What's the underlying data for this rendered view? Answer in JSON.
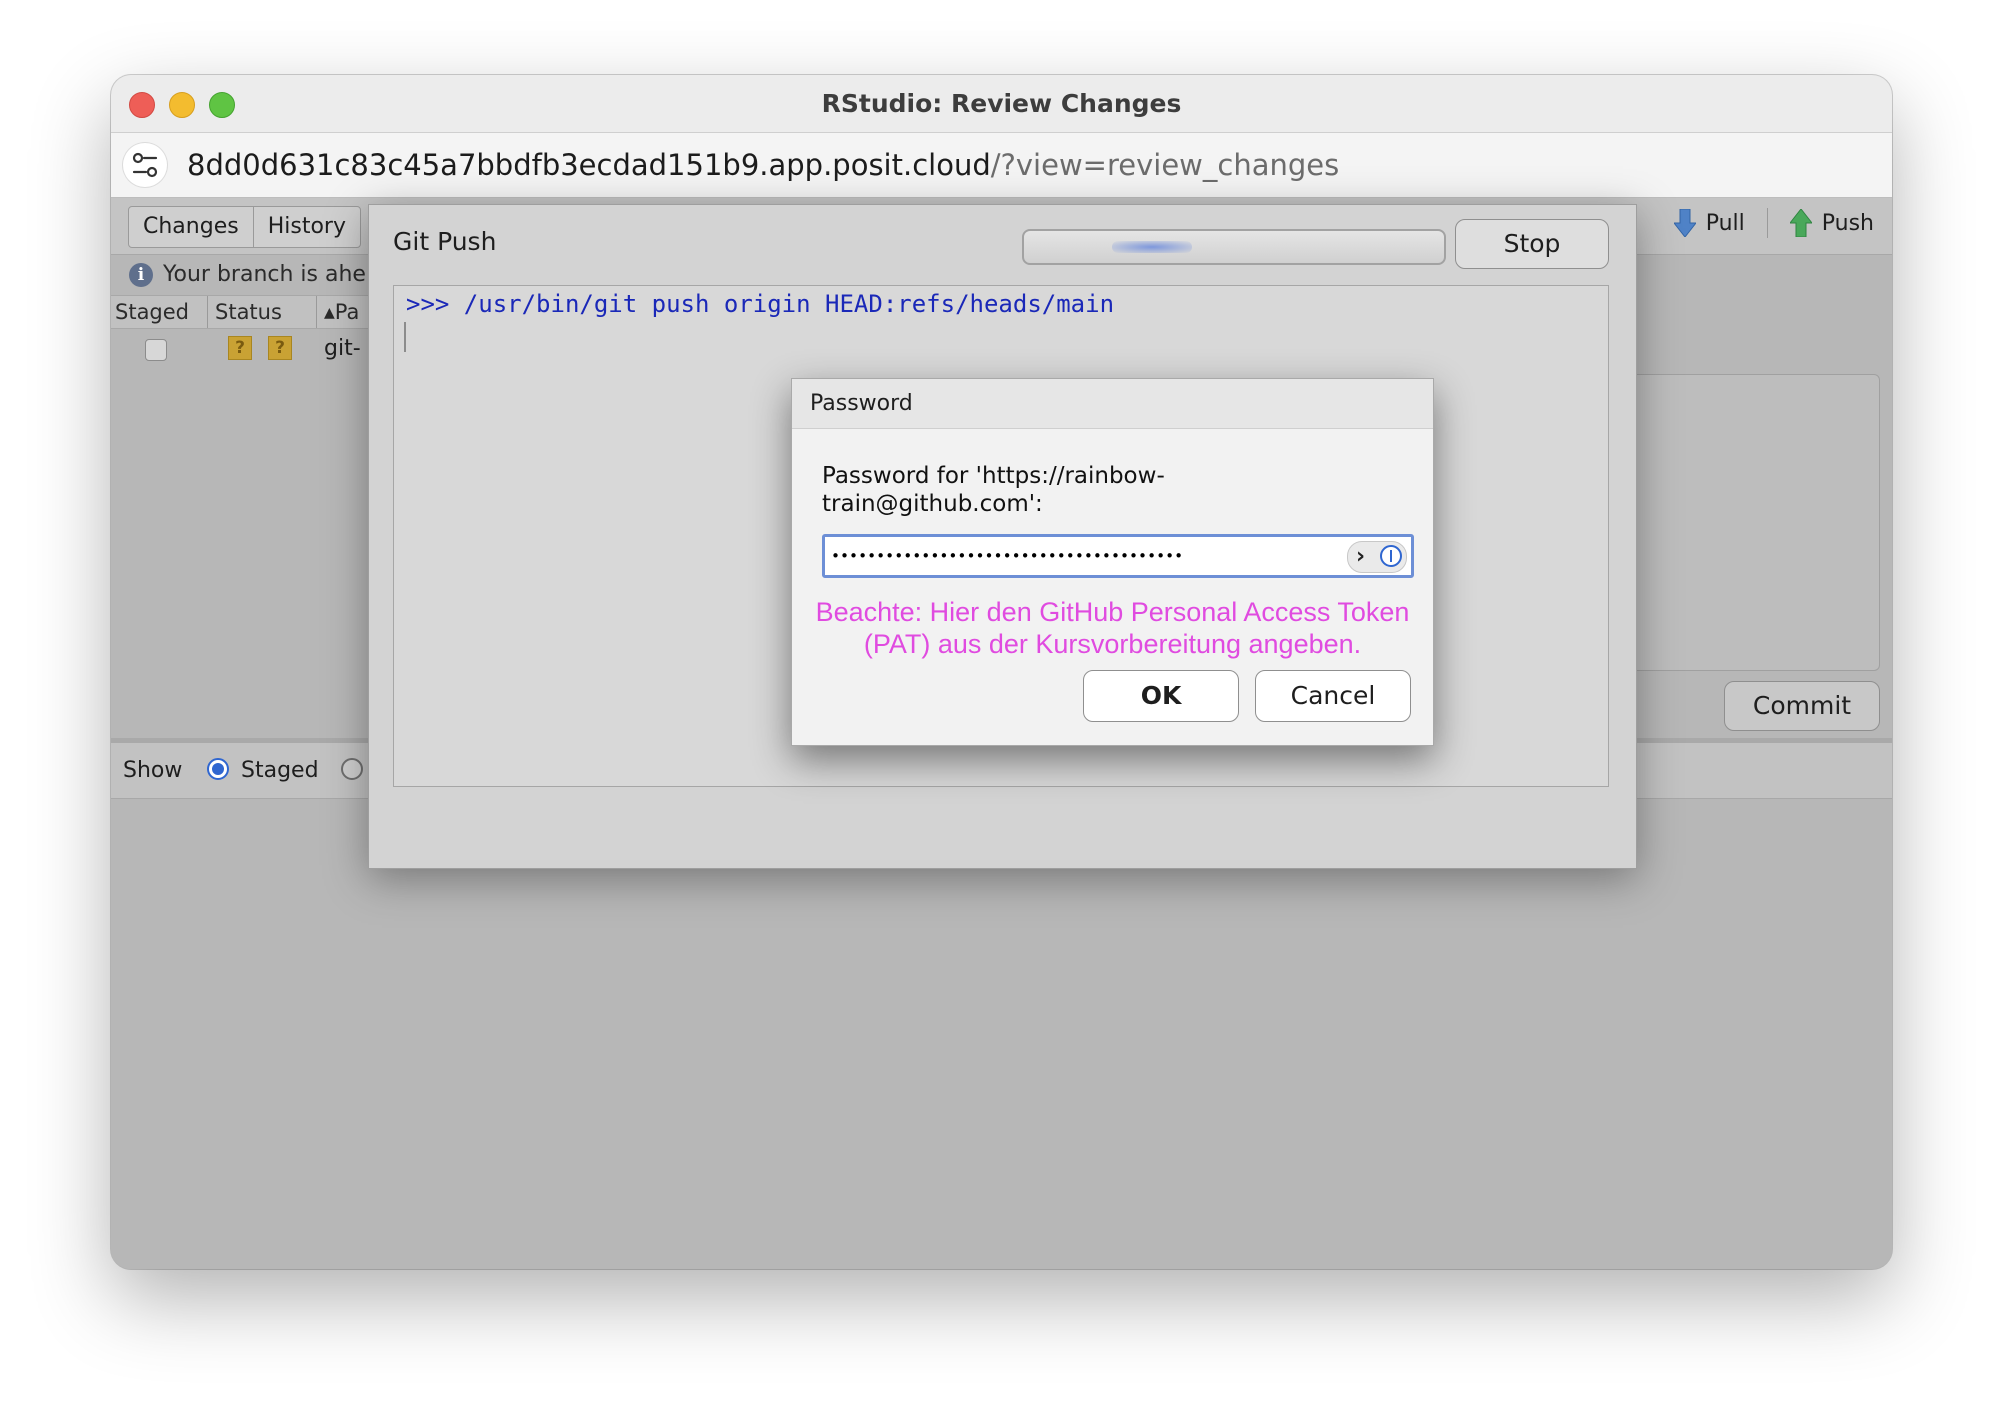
{
  "window": {
    "title": "RStudio: Review Changes",
    "url_host": "8dd0d631c83c45a7bbdfb3ecdad151b9.app.posit.cloud",
    "url_path": "/?view=review_changes"
  },
  "review": {
    "tabs": [
      {
        "label": "Changes"
      },
      {
        "label": "History"
      }
    ],
    "pull_label": "Pull",
    "push_label": "Push",
    "info_text": "Your branch is ahe",
    "columns": {
      "staged": "Staged",
      "status": "Status",
      "path": "Pa"
    },
    "file_row": {
      "name": "git-",
      "badge1": "?",
      "badge2": "?"
    },
    "commit_label": "Commit",
    "show_label": "Show",
    "staged_option": "Staged"
  },
  "git_push": {
    "title": "Git Push",
    "stop_label": "Stop",
    "console_line": ">>> /usr/bin/git push origin HEAD:refs/heads/main"
  },
  "password_dialog": {
    "title": "Password",
    "prompt_line1": "Password for 'https://rainbow-",
    "prompt_line2": "train@github.com':",
    "masked_value": "•••••••••••••••••••••••••••••••••••••••",
    "note_line1": "Beachte: Hier den GitHub Personal Access Token",
    "note_line2": "(PAT) aus der Kursvorbereitung angeben.",
    "note_color": "#e04be0",
    "ok_label": "OK",
    "cancel_label": "Cancel"
  }
}
